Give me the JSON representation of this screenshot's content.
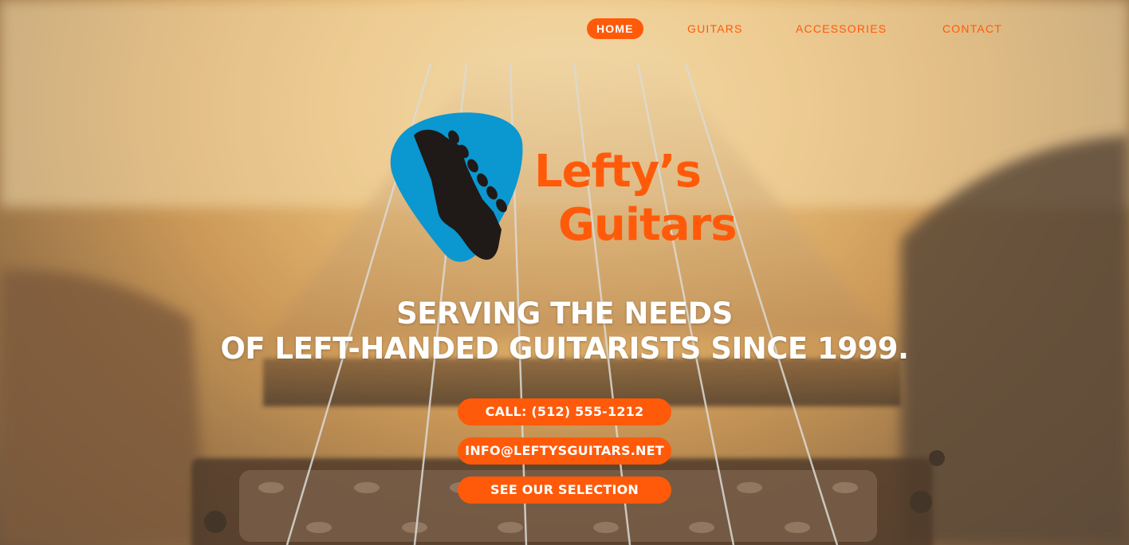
{
  "nav": {
    "items": [
      {
        "label": "HOME",
        "active": true
      },
      {
        "label": "GUITARS",
        "active": false
      },
      {
        "label": "ACCESSORIES",
        "active": false
      },
      {
        "label": "CONTACT",
        "active": false
      }
    ]
  },
  "logo": {
    "line1": "Lefty’s",
    "line2": "Guitars",
    "icon": "guitar-pick-headstock-icon",
    "pick_color": "#0b97d0",
    "headstock_color": "#1f1a17",
    "text_color": "#ff5a0a"
  },
  "headline": {
    "line1": "SERVING THE NEEDS",
    "line2": "OF LEFT-HANDED GUITARISTS SINCE 1999."
  },
  "buttons": {
    "call": "CALL: (512) 555-1212",
    "email": "INFO@LEFTYSGUITARS.NET",
    "selection": "SEE OUR SELECTION"
  },
  "colors": {
    "accent": "#ff5a0a",
    "text_light": "#ffffff"
  }
}
